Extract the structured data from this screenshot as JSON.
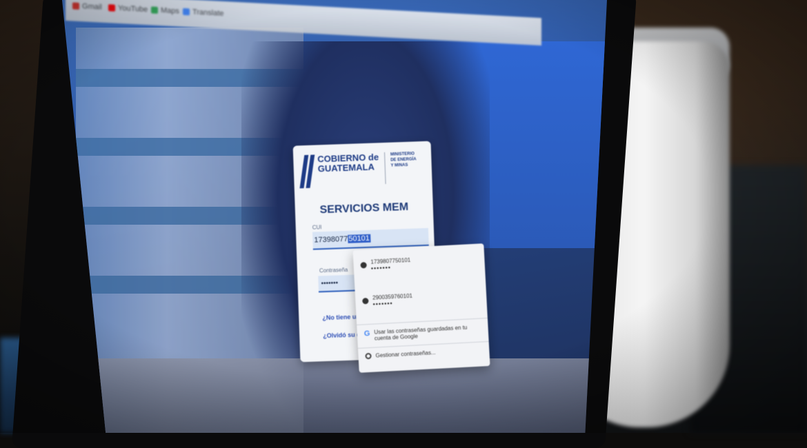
{
  "browser": {
    "bookmarks": [
      {
        "label": "Gmail",
        "color": "#d93025"
      },
      {
        "label": "YouTube",
        "color": "#ff0000"
      },
      {
        "label": "Maps",
        "color": "#34a853"
      },
      {
        "label": "Translate",
        "color": "#4285f4"
      }
    ]
  },
  "login": {
    "logo_line1": "COBIERNO de",
    "logo_line2": "GUATEMALA",
    "ministry": "MINISTERIO DE ENERGÍA Y MINAS",
    "title": "SERVICIOS MEM",
    "cui_label": "CUI",
    "cui_value": "17398077",
    "cui_selected": "50101",
    "password_label": "Contraseña",
    "password_value": "•••••••",
    "link_register": "¿No tiene una c",
    "link_forgot": "¿Olvidó su con"
  },
  "autofill": {
    "entries": [
      {
        "username": "1739807750101",
        "password": "•••••••"
      },
      {
        "username": "2900359760101",
        "password": "•••••••"
      }
    ],
    "google_option": "Usar las contraseñas guardadas en tu cuenta de Google",
    "manage_option": "Gestionar contraseñas..."
  },
  "colors": {
    "brand_blue": "#1d3b86",
    "selection": "#2f5ec8"
  }
}
